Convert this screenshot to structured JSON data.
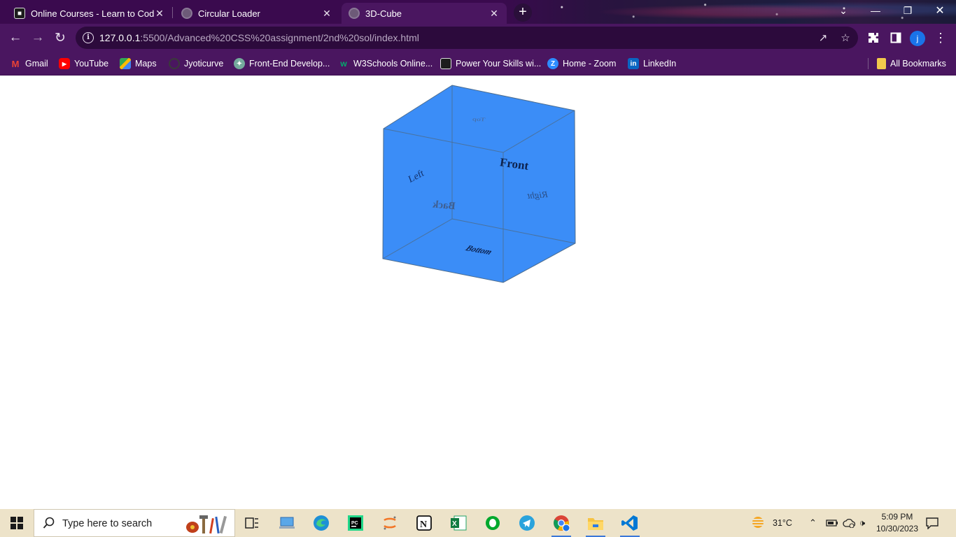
{
  "browser": {
    "tabs": [
      {
        "title": "Online Courses - Learn to Code ...",
        "favicon": "codecademy-icon"
      },
      {
        "title": "Circular Loader",
        "favicon": "globe-icon"
      },
      {
        "title": "3D-Cube",
        "favicon": "globe-icon",
        "active": true
      }
    ],
    "new_tab": "+",
    "address": {
      "host": "127.0.0.1",
      "path": ":5500/Advanced%20CSS%20assignment/2nd%20sol/index.html"
    },
    "profile_initial": "j",
    "bookmarks": [
      {
        "label": "Gmail"
      },
      {
        "label": "YouTube"
      },
      {
        "label": "Maps"
      },
      {
        "label": "Jyoticurve"
      },
      {
        "label": "Front-End Develop..."
      },
      {
        "label": "W3Schools Online..."
      },
      {
        "label": "Power Your Skills wi..."
      },
      {
        "label": "Home - Zoom"
      },
      {
        "label": "LinkedIn"
      }
    ],
    "all_bookmarks": "All Bookmarks"
  },
  "cube": {
    "color": "#3b8df7",
    "edge_color": "#4c6d8f",
    "faces": {
      "front": "Front",
      "back": "Back",
      "left": "Left",
      "right": "Right",
      "top": "Top",
      "bottom": "Bottom"
    }
  },
  "taskbar": {
    "search_placeholder": "Type here to search",
    "weather": "31°C",
    "time": "5:09 PM",
    "date": "10/30/2023"
  }
}
